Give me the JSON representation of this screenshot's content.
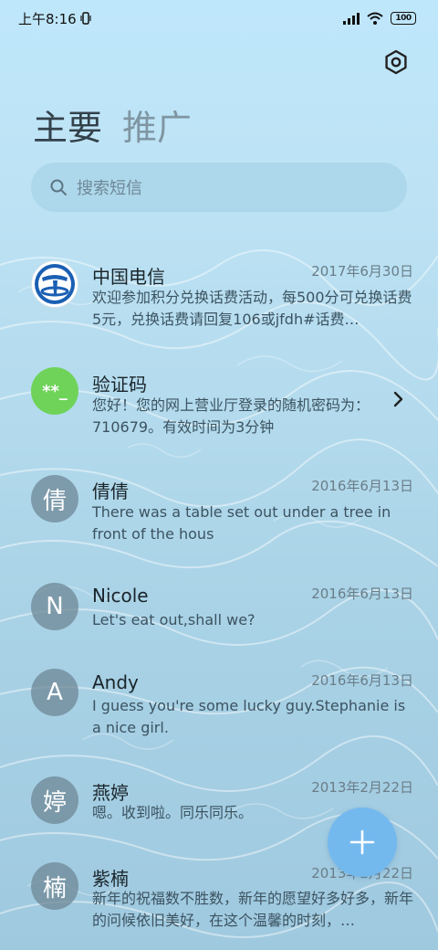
{
  "status_bar": {
    "time": "上午8:16",
    "battery": "100"
  },
  "header": {
    "settings_icon": "hexagon-gear-icon",
    "tabs": [
      {
        "label": "主要",
        "active": true
      },
      {
        "label": "推广",
        "active": false
      }
    ]
  },
  "search": {
    "placeholder": "搜索短信"
  },
  "conversations": [
    {
      "avatar_type": "china-telecom-logo",
      "name": "中国电信",
      "date": "2017年6月30日",
      "preview": "欢迎参加积分兑换话费活动，每500分可兑换话费5元，兑换话费请回复106或jfdh#话费…"
    },
    {
      "avatar_type": "verification-code",
      "avatar_text": "**_",
      "avatar_color": "#6fd35a",
      "name": "验证码",
      "date": "",
      "preview": "您好！您的网上营业厅登录的随机密码为：710679。有效时间为3分钟"
    },
    {
      "avatar_text": "倩",
      "name": "倩倩",
      "date": "2016年6月13日",
      "preview": "There was a table set out under a tree in front of the hous"
    },
    {
      "avatar_text": "N",
      "name": "Nicole",
      "date": "2016年6月13日",
      "preview": "Let's eat out,shall we?"
    },
    {
      "avatar_text": "A",
      "name": "Andy",
      "date": "2016年6月13日",
      "preview": "I guess you're some lucky guy.Stephanie is a nice girl."
    },
    {
      "avatar_text": "婷",
      "name": "燕婷",
      "date": "2013年2月22日",
      "preview": "嗯。收到啦。同乐同乐。"
    },
    {
      "avatar_text": "楠",
      "name": "紫楠",
      "date": "2013年2月22日",
      "preview": "新年的祝福数不胜数，新年的愿望好多好多，新年的问候依旧美好，在这个温馨的时刻，…"
    }
  ],
  "fab": {
    "icon": "plus-icon",
    "color": "#74b9ee"
  }
}
